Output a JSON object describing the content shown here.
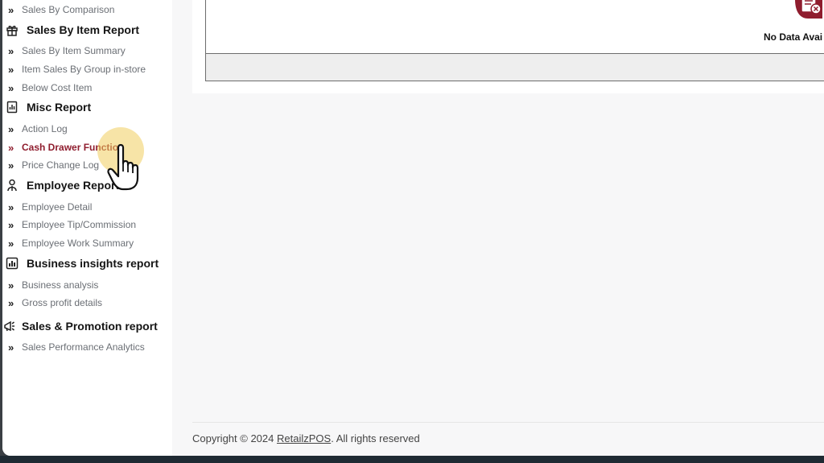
{
  "sidebar": {
    "items_top": [
      {
        "label": "Sales By Comparison"
      }
    ],
    "sections": [
      {
        "title": "Sales By Item Report",
        "icon": "gift-icon",
        "items": [
          "Sales By Item Summary",
          "Item Sales By Group in-store",
          "Below Cost Item"
        ]
      },
      {
        "title": "Misc Report",
        "icon": "report-icon",
        "items": [
          "Action Log",
          "Cash Drawer Function",
          "Price Change Log"
        ]
      },
      {
        "title": "Employee Report",
        "icon": "person-icon",
        "items": [
          "Employee Detail",
          "Employee Tip/Commission",
          "Employee Work Summary"
        ]
      },
      {
        "title": "Business insights report",
        "icon": "bar-chart-icon",
        "items": [
          "Business analysis",
          "Gross profit details"
        ]
      },
      {
        "title": "Sales & Promotion report",
        "icon": "megaphone-icon",
        "items": [
          "Sales Performance Analytics"
        ]
      }
    ],
    "active_item": "Cash Drawer Function"
  },
  "main": {
    "no_data_text": "No Data Avai",
    "no_data_icon": "no-data-icon"
  },
  "footer": {
    "prefix": "Copyright © 2024 ",
    "brand": "RetailzPOS",
    "suffix": ". All rights reserved"
  },
  "colors": {
    "accent": "#8f1d2e",
    "highlight": "#f0cd5f"
  }
}
